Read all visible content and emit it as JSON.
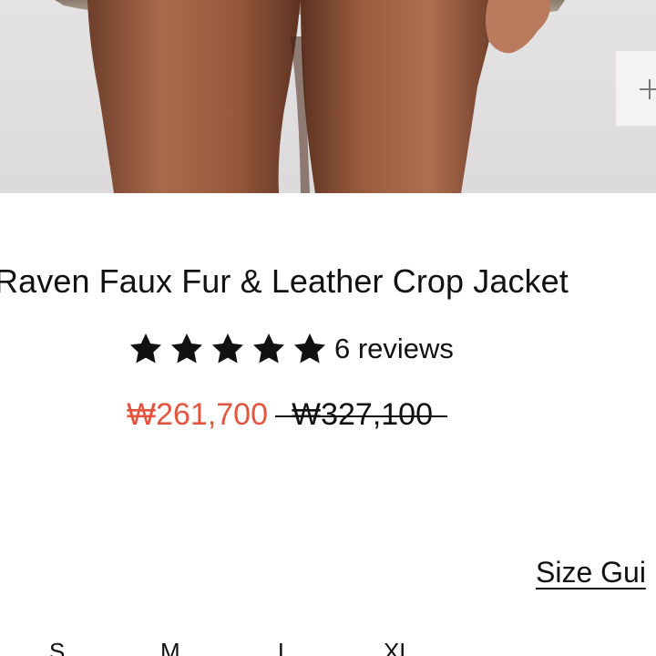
{
  "image": {
    "alt": "Raven Faux Fur & Leather Crop Jacket",
    "zoom_icon": "plus-icon"
  },
  "product": {
    "title": "Raven Faux Fur & Leather Crop Jacket",
    "rating": 5,
    "rating_max": 5,
    "star_icon": "star-icon",
    "review_count_label": "6 reviews",
    "sale_price": "₩261,700",
    "original_price": "₩327,100"
  },
  "sizing": {
    "size_guide_label": "Size Gui",
    "sizes": [
      "S",
      "M",
      "L",
      "XL"
    ]
  },
  "colors": {
    "sale_price": "#e4553f",
    "text": "#111111",
    "image_background": "#e0dedf",
    "skin_tone": "#9c5f43"
  }
}
